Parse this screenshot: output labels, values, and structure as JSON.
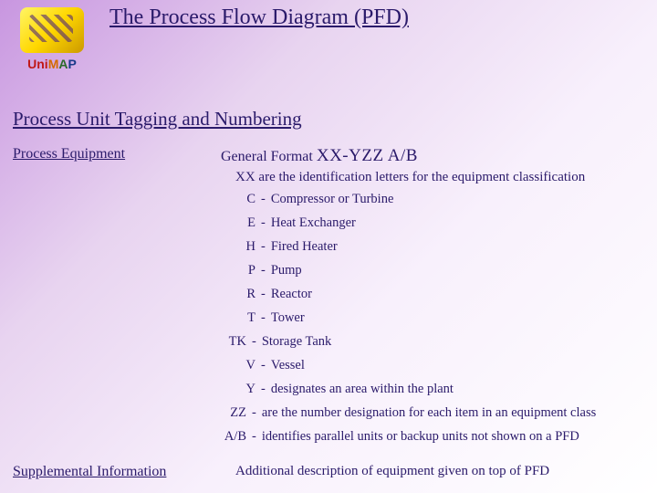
{
  "logo": {
    "u": "Uni",
    "m": "M",
    "a": "A",
    "p": "P"
  },
  "title": "The Process Flow Diagram (PFD)",
  "subtitle": "Process Unit Tagging and Numbering",
  "processEquipmentLabel": "Process Equipment",
  "generalFormat": {
    "prefix": "General Format ",
    "pattern": "XX-YZZ A/B"
  },
  "xx": {
    "code": "XX",
    "desc": " are the identification letters for the equipment classification"
  },
  "items": [
    {
      "code": "C",
      "desc": "Compressor or Turbine"
    },
    {
      "code": "E",
      "desc": "Heat Exchanger"
    },
    {
      "code": "H",
      "desc": "Fired Heater"
    },
    {
      "code": "P",
      "desc": "Pump"
    },
    {
      "code": "R",
      "desc": "Reactor"
    },
    {
      "code": "T",
      "desc": "Tower"
    },
    {
      "code": "TK",
      "desc": "Storage Tank"
    },
    {
      "code": "V",
      "desc": "Vessel"
    },
    {
      "code": "Y",
      "desc": "designates an area within the plant"
    },
    {
      "code": "ZZ",
      "desc": "are the number designation for each item in an equipment class"
    },
    {
      "code": "A/B",
      "desc": "identifies parallel units or backup units not shown on a PFD"
    }
  ],
  "supplemental": {
    "label": "Supplemental Information",
    "desc": "Additional description of equipment given on top of PFD"
  },
  "dash": "-"
}
